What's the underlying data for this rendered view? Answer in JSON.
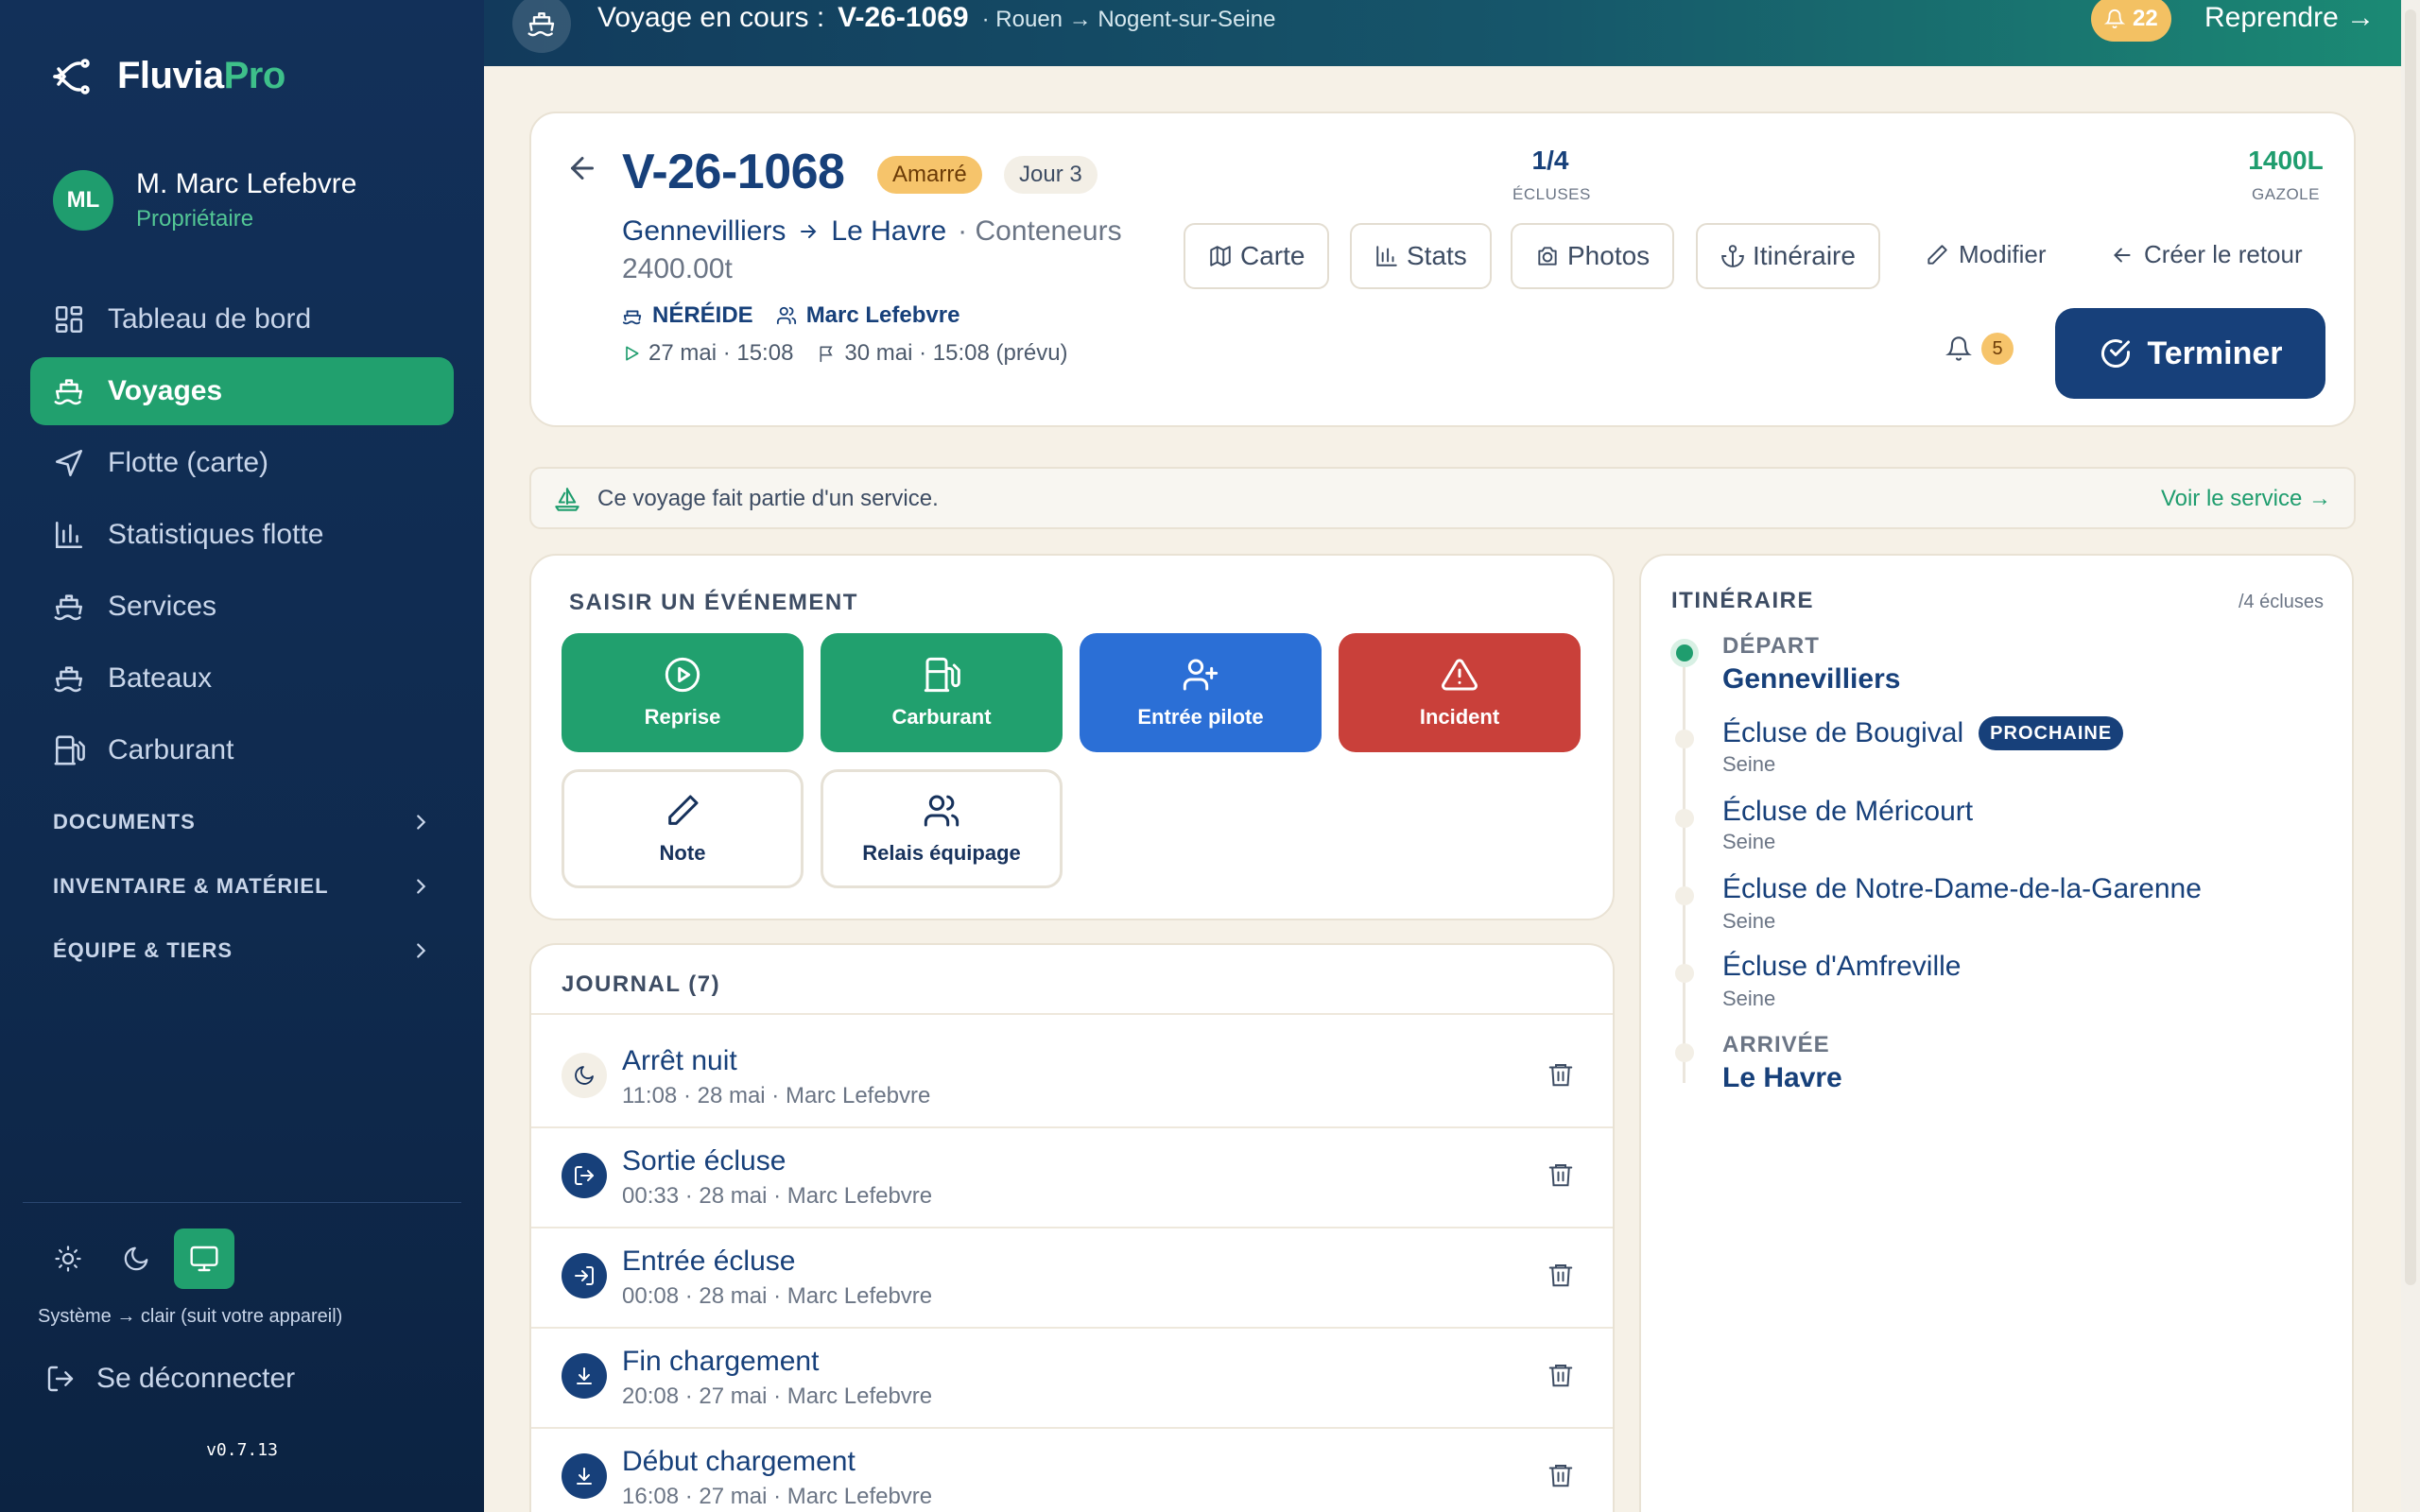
{
  "app": {
    "brand_main": "Fluvia",
    "brand_accent": "Pro",
    "version": "v0.7.13"
  },
  "user": {
    "initials": "ML",
    "name": "M. Marc Lefebvre",
    "role": "Propriétaire"
  },
  "sidebar": {
    "items": [
      {
        "label": "Tableau de bord",
        "icon": "dashboard-icon"
      },
      {
        "label": "Voyages",
        "icon": "ship-icon",
        "active": true
      },
      {
        "label": "Flotte (carte)",
        "icon": "navigation-icon"
      },
      {
        "label": "Statistiques flotte",
        "icon": "bar-chart-icon"
      },
      {
        "label": "Services",
        "icon": "ship-icon"
      },
      {
        "label": "Bateaux",
        "icon": "ship-icon"
      },
      {
        "label": "Carburant",
        "icon": "fuel-icon"
      }
    ],
    "sections": [
      {
        "label": "DOCUMENTS"
      },
      {
        "label": "INVENTAIRE & MATÉRIEL"
      },
      {
        "label": "ÉQUIPE & TIERS"
      }
    ],
    "theme_text": "Système → clair (suit votre appareil)",
    "logout_label": "Se déconnecter"
  },
  "topbar": {
    "prefix": "Voyage en cours :",
    "voyage_id": "V-26-1069",
    "route": "· Rouen → Nogent-sur-Seine",
    "notification_count": "22",
    "resume_label": "Reprendre →"
  },
  "voyage": {
    "id": "V-26-1068",
    "status": "Amarré",
    "day": "Jour 3",
    "from": "Gennevilliers",
    "to": "Le Havre",
    "cargo": "· Conteneurs",
    "tonnage": "2400.00t",
    "boat": "NÉRÉIDE",
    "captain": "Marc Lefebvre",
    "start": "27 mai · 15:08",
    "end": "30 mai · 15:08 (prévu)",
    "locks_value": "1/4",
    "locks_label": "ÉCLUSES",
    "fuel_value": "1400L",
    "fuel_label": "GAZOLE",
    "alert_count": "5"
  },
  "toolbar": {
    "map": "Carte",
    "stats": "Stats",
    "photos": "Photos",
    "itinerary": "Itinéraire",
    "edit": "Modifier",
    "create_return": "Créer le retour",
    "finish": "Terminer"
  },
  "service_banner": {
    "text": "Ce voyage fait partie d'un service.",
    "link": "Voir le service →"
  },
  "events": {
    "title": "SAISIR UN ÉVÉNEMENT",
    "buttons": [
      {
        "label": "Reprise"
      },
      {
        "label": "Carburant"
      },
      {
        "label": "Entrée pilote"
      },
      {
        "label": "Incident"
      },
      {
        "label": "Note"
      },
      {
        "label": "Relais équipage"
      }
    ]
  },
  "journal": {
    "title": "JOURNAL (7)",
    "entries": [
      {
        "title": "Arrêt nuit",
        "sub": "11:08 · 28 mai · Marc Lefebvre"
      },
      {
        "title": "Sortie écluse",
        "sub": "00:33 · 28 mai · Marc Lefebvre"
      },
      {
        "title": "Entrée écluse",
        "sub": "00:08 · 28 mai · Marc Lefebvre"
      },
      {
        "title": "Fin chargement",
        "sub": "20:08 · 27 mai · Marc Lefebvre"
      },
      {
        "title": "Début chargement",
        "sub": "16:08 · 27 mai · Marc Lefebvre"
      }
    ]
  },
  "itinerary": {
    "title": "ITINÉRAIRE",
    "count": "/4 écluses",
    "departure_label": "DÉPART",
    "departure": "Gennevilliers",
    "next_badge": "PROCHAINE",
    "locks": [
      {
        "name": "Écluse de Bougival",
        "river": "Seine"
      },
      {
        "name": "Écluse de Méricourt",
        "river": "Seine"
      },
      {
        "name": "Écluse de Notre-Dame-de-la-Garenne",
        "river": "Seine"
      },
      {
        "name": "Écluse d'Amfreville",
        "river": "Seine"
      }
    ],
    "arrival_label": "ARRIVÉE",
    "arrival": "Le Havre"
  },
  "colors": {
    "navy": "#17407a",
    "green": "#21a06e",
    "blue": "#2b6fd6",
    "red": "#c9403a",
    "amber": "#f6c46b"
  }
}
